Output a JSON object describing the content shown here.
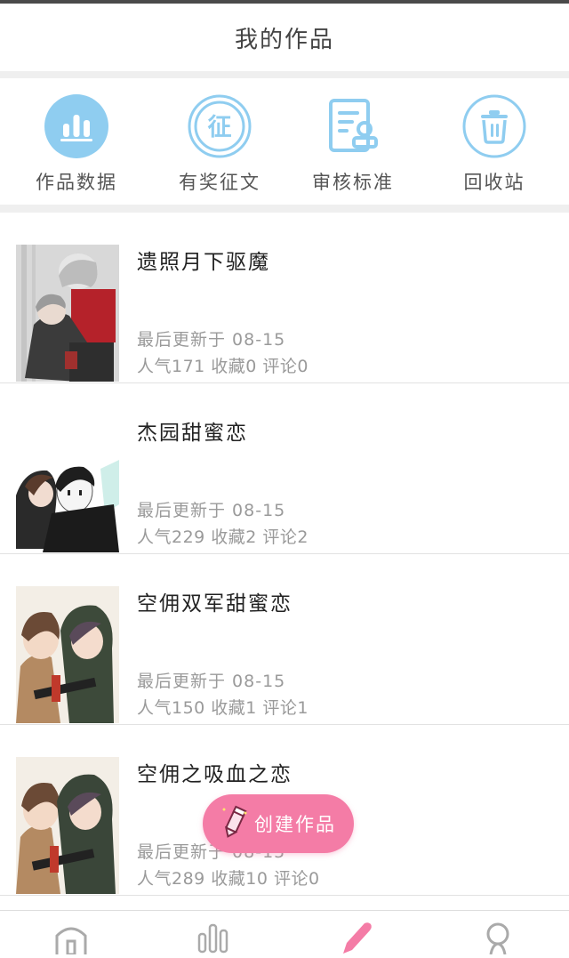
{
  "header": {
    "title": "我的作品"
  },
  "quicknav": [
    {
      "label": "作品数据",
      "icon": "bar-chart-icon"
    },
    {
      "label": "有奖征文",
      "icon": "contest-icon",
      "glyph": "征"
    },
    {
      "label": "审核标准",
      "icon": "review-document-icon"
    },
    {
      "label": "回收站",
      "icon": "trash-icon"
    }
  ],
  "works": [
    {
      "title": "遗照月下驱魔",
      "updated": "最后更新于 08-15",
      "stats": "人气171 收藏0 评论0"
    },
    {
      "title": "杰园甜蜜恋",
      "updated": "最后更新于 08-15",
      "stats": "人气229 收藏2 评论2"
    },
    {
      "title": "空佣双军甜蜜恋",
      "updated": "最后更新于 08-15",
      "stats": "人气150 收藏1 评论1"
    },
    {
      "title": "空佣之吸血之恋",
      "updated": "最后更新于 08-15",
      "stats": "人气289 收藏10 评论0"
    }
  ],
  "fab": {
    "label": "创建作品"
  },
  "bottom_nav": [
    {
      "icon": "home-icon"
    },
    {
      "icon": "stats-icon"
    },
    {
      "icon": "pencil-icon"
    },
    {
      "icon": "profile-icon"
    }
  ],
  "colors": {
    "accent_blue": "#8fcdf0",
    "accent_pink": "#f47ca6",
    "text_gray": "#9a9a9a"
  }
}
